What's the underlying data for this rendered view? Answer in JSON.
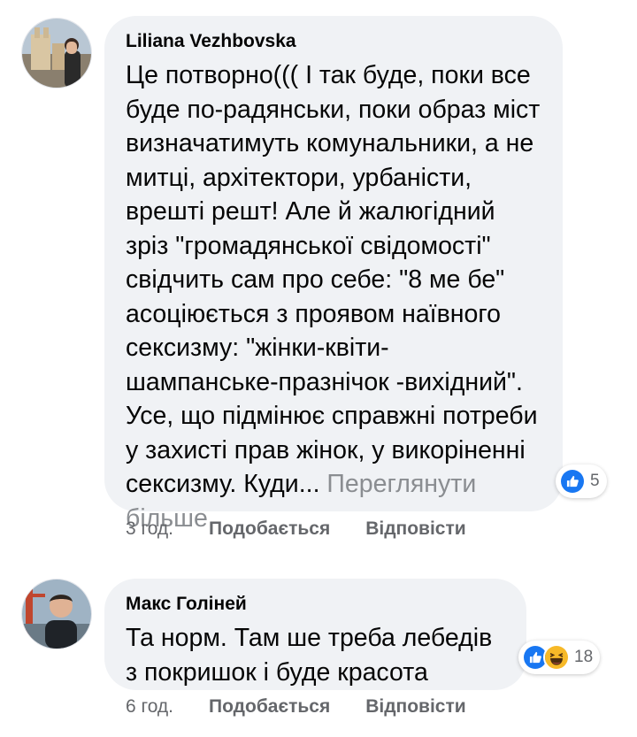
{
  "comments": [
    {
      "author": "Liliana Vezhbovska",
      "text": "Це потворно((( І так буде, поки все буде по-радянськи, поки образ міст визначатимуть комунальники, а не митці, архітектори, урбаністи, врешті решт! Але й жалюгідний зріз \"громадянської свідомості\" свідчить сам про себе: \"8 ме бе\" асоціюється з проявом наївного сексизму: \"жінки-квіти-шампанське-празнічок -вихідний\". Усе, що підмінює справжні потреби у захисті прав жінок, у викоріненні сексизму. Куди...",
      "see_more": "Переглянути більше",
      "reaction_count": "5",
      "time": "3 год.",
      "like_label": "Подобається",
      "reply_label": "Відповісти"
    },
    {
      "author": "Макс Голіней",
      "text": "Та норм. Там ше треба лебедів з покришок і буде красота",
      "reaction_count": "18",
      "time": "6 год.",
      "like_label": "Подобається",
      "reply_label": "Відповісти"
    }
  ],
  "colors": {
    "bubble": "#f0f2f5",
    "muted": "#65676b",
    "see_more": "#8a8d91",
    "like_blue": "#1877f2",
    "haha_yellow": "#f7b928"
  }
}
